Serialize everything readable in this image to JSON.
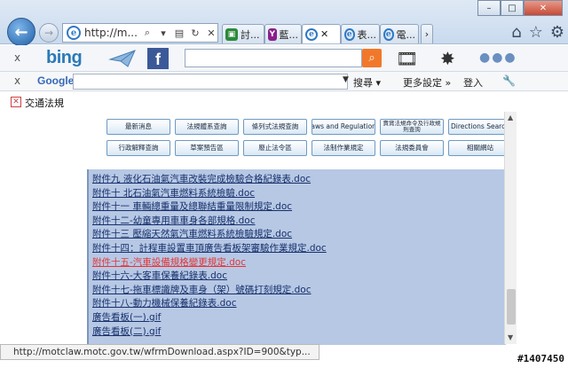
{
  "browser": {
    "address_text": "http://m...",
    "tabs": [
      {
        "label": "討...",
        "fav": "#2b8a3a"
      },
      {
        "label": "藍...",
        "fav": "#8a1f8a"
      },
      {
        "label": "",
        "fav": "#2f78c6",
        "active": true
      },
      {
        "label": "表...",
        "fav": "#2f78c6"
      },
      {
        "label": "電...",
        "fav": "#2f78c6"
      }
    ],
    "window_buttons": {
      "minimize": "–",
      "maximize": "□",
      "close": "✕"
    }
  },
  "bing_toolbar": {
    "close": "x",
    "logo": "bing",
    "facebook": "f",
    "search_placeholder": ""
  },
  "google_toolbar": {
    "close": "x",
    "logo": "Google",
    "search_label": "搜尋 ▾",
    "more_label": "更多設定 »",
    "login_label": "登入"
  },
  "favorites": {
    "label": "交通法規"
  },
  "nav_buttons": [
    "最新消息",
    "法規體系查詢",
    "條列式法規查詢",
    "Laws and Regulations",
    "賣賞法規命令及行政規則查詢",
    "Directions Search",
    "行政解釋查詢",
    "草案預告區",
    "廢止法令區",
    "法制作業規定",
    "法規委員會",
    "相關網站"
  ],
  "files": [
    {
      "name": "附件九 液化石油氣汽車改裝完成檢驗合格紀錄表.doc"
    },
    {
      "name": "附件十 北石油氣汽車燃料系統檢驗.doc"
    },
    {
      "name": "附件十一 車輛總重量及總聯結重量限制規定.doc"
    },
    {
      "name": "附件十二-幼童專用車車身各部規格.doc"
    },
    {
      "name": "附件十三 壓縮天然氣汽車燃料系統檢驗規定.doc"
    },
    {
      "name": "附件十四：計程車設置車頂廣告看板架審驗作業規定.doc"
    },
    {
      "name": "附件十五-汽車設備規格變更規定.doc",
      "highlight": true
    },
    {
      "name": "附件十六-大客車保養紀錄表.doc"
    },
    {
      "name": "附件十七-拖車標識牌及車身（架）號碼打刻規定.doc"
    },
    {
      "name": "附件十八-動力機械保養紀錄表.doc"
    },
    {
      "name": "廣告看板(一).gif"
    },
    {
      "name": "廣告看板(二).gif"
    }
  ],
  "status_text": "http://motclaw.motc.gov.tw/wfrmDownload.aspx?ID=900&typ...",
  "watermark": "#1407450"
}
